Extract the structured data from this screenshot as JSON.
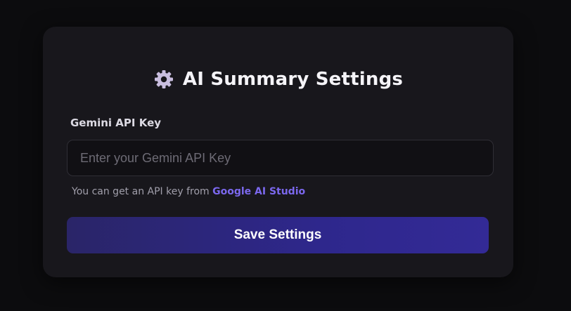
{
  "settings": {
    "title": "AI Summary Settings",
    "icon": "gear-icon",
    "field_label": "Gemini API Key",
    "input_value": "",
    "input_placeholder": "Enter your Gemini API Key",
    "hint_prefix": "You can get an API key from ",
    "hint_link": "Google AI Studio",
    "save_label": "Save Settings"
  },
  "colors": {
    "page_background": "#0c0c0e",
    "card_background": "#18171c",
    "link": "#7b68ee",
    "button_start": "#2a2568",
    "button_end": "#332a96",
    "icon": "#c9bedf"
  }
}
